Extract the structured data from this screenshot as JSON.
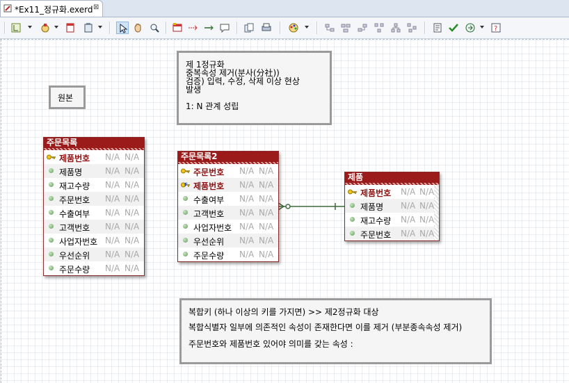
{
  "editor": {
    "tab_title": "*Ex11_정규화.exerd",
    "close_glyph": "⊠"
  },
  "toolbar": {
    "icons": [
      "layout-icon",
      "palette-icon",
      "note-icon",
      "clipboard-icon",
      "select-icon",
      "hand-icon",
      "zoom-icon",
      "table-icon",
      "relation-icon",
      "relation-id-icon",
      "comment-icon",
      "copy-icon",
      "print-icon",
      "color-icon",
      "align-icon",
      "align-center-icon",
      "align-right-icon",
      "distribute-icon",
      "tree-icon",
      "validate-icon",
      "check-icon",
      "export-icon",
      "help-icon"
    ]
  },
  "notes": {
    "original": "원본",
    "rule1": {
      "l1": "제 1정규화",
      "l2": "중복속성 제거(분사(分社))",
      "l3": "검증) 입력, 수정, 삭제 이상 현상",
      "l4": "발생",
      "l5": "1: N 관계 성립"
    },
    "rule2": {
      "l1": "복합키 (하나 이상의 키를 가지면)  >>  제2정규화 대상",
      "l2": "복합식별자 일부에 의존적인 속성이 존재한다면 이를 제거 (부분종속속성 제거)",
      "l3": "주문번호와 제품번호 있어야 의미를 갖는 속성 :"
    }
  },
  "entities": {
    "e1": {
      "title": "주문목록",
      "rows": [
        {
          "name": "제품번호",
          "d1": "N/A",
          "d2": "N/A"
        },
        {
          "name": "제품명",
          "d1": "N/A",
          "d2": "N/A"
        },
        {
          "name": "재고수량",
          "d1": "N/A",
          "d2": "N/A"
        },
        {
          "name": "주문번호",
          "d1": "N/A",
          "d2": "N/A"
        },
        {
          "name": "수출여부",
          "d1": "N/A",
          "d2": "N/A"
        },
        {
          "name": "고객번호",
          "d1": "N/A",
          "d2": "N/A"
        },
        {
          "name": "사업자번호",
          "d1": "N/A",
          "d2": "N/A"
        },
        {
          "name": "우선순위",
          "d1": "N/A",
          "d2": "N/A"
        },
        {
          "name": "주문수량",
          "d1": "N/A",
          "d2": "N/A"
        }
      ]
    },
    "e2": {
      "title": "주문목록2",
      "rows": [
        {
          "name": "주문번호",
          "d1": "N/A",
          "d2": "N/A"
        },
        {
          "name": "제품번호",
          "d1": "N/A",
          "d2": "N/A"
        },
        {
          "name": "수출여부",
          "d1": "N/A",
          "d2": "N/A"
        },
        {
          "name": "고객번호",
          "d1": "N/A",
          "d2": "N/A"
        },
        {
          "name": "사업자번호",
          "d1": "N/A",
          "d2": "N/A"
        },
        {
          "name": "우선순위",
          "d1": "N/A",
          "d2": "N/A"
        },
        {
          "name": "주문수량",
          "d1": "N/A",
          "d2": "N/A"
        }
      ]
    },
    "e3": {
      "title": "제품",
      "rows": [
        {
          "name": "제품번호",
          "d1": "N/A",
          "d2": "N/A"
        },
        {
          "name": "제품명",
          "d1": "N/A",
          "d2": "N/A"
        },
        {
          "name": "재고수량",
          "d1": "N/A",
          "d2": "N/A"
        },
        {
          "name": "주문번호",
          "d1": "N/A",
          "d2": "N/A"
        }
      ]
    }
  },
  "colors": {
    "entity_header": "#9b1b1b",
    "pk_text": "#8e0f0f",
    "relation_line": "#3f6b3a",
    "na_text": "#a9a9a9"
  }
}
